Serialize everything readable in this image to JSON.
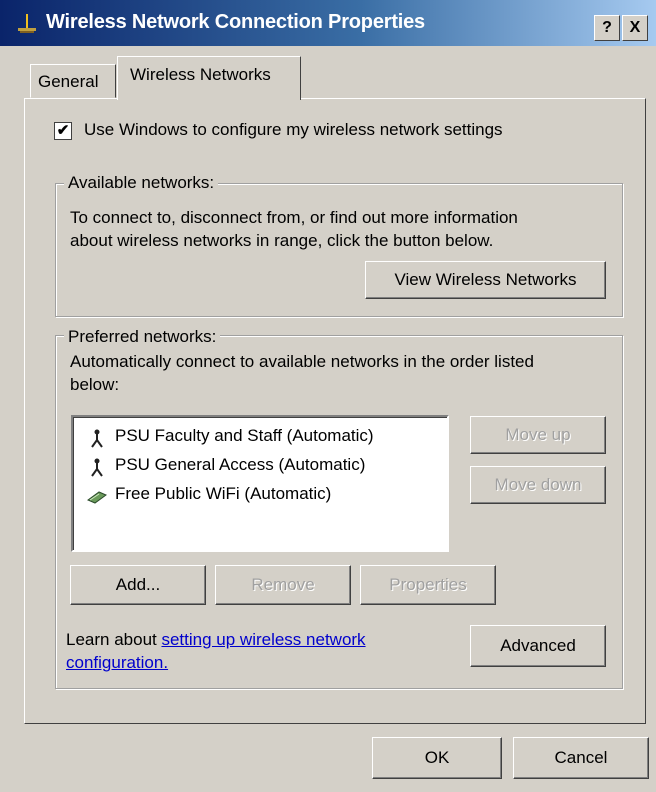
{
  "window": {
    "title": "Wireless Network Connection Properties",
    "help_label": "?",
    "close_label": "X"
  },
  "tabs": [
    {
      "label": "General",
      "active": false
    },
    {
      "label": "Wireless Networks",
      "active": true
    }
  ],
  "use_windows": {
    "label": "Use Windows to configure my wireless network settings",
    "checked": true,
    "check_glyph": "✔"
  },
  "available": {
    "legend": "Available networks:",
    "desc_line1": "To connect to, disconnect from, or find out more information",
    "desc_line2": "about wireless networks in range, click the button below.",
    "view_button": "View Wireless Networks"
  },
  "preferred": {
    "legend": "Preferred networks:",
    "desc_line1": "Automatically connect to available networks in the order listed",
    "desc_line2": "below:",
    "networks": [
      {
        "label": "PSU Faculty and Staff (Automatic)",
        "icon": "antenna-icon"
      },
      {
        "label": "PSU General Access (Automatic)",
        "icon": "antenna-icon"
      },
      {
        "label": "Free Public WiFi (Automatic)",
        "icon": "adhoc-network-icon"
      }
    ],
    "move_up": "Move up",
    "move_down": "Move down",
    "add": "Add...",
    "remove": "Remove",
    "properties": "Properties",
    "learn_prefix": "Learn about ",
    "learn_link_line1": "setting up wireless network",
    "learn_link_line2": "configuration.",
    "advanced": "Advanced"
  },
  "footer": {
    "ok": "OK",
    "cancel": "Cancel"
  },
  "colors": {
    "dialog_bg": "#d4d0c8",
    "titlebar_start": "#0a246a",
    "titlebar_end": "#a6caf0",
    "link": "#0000cc"
  }
}
